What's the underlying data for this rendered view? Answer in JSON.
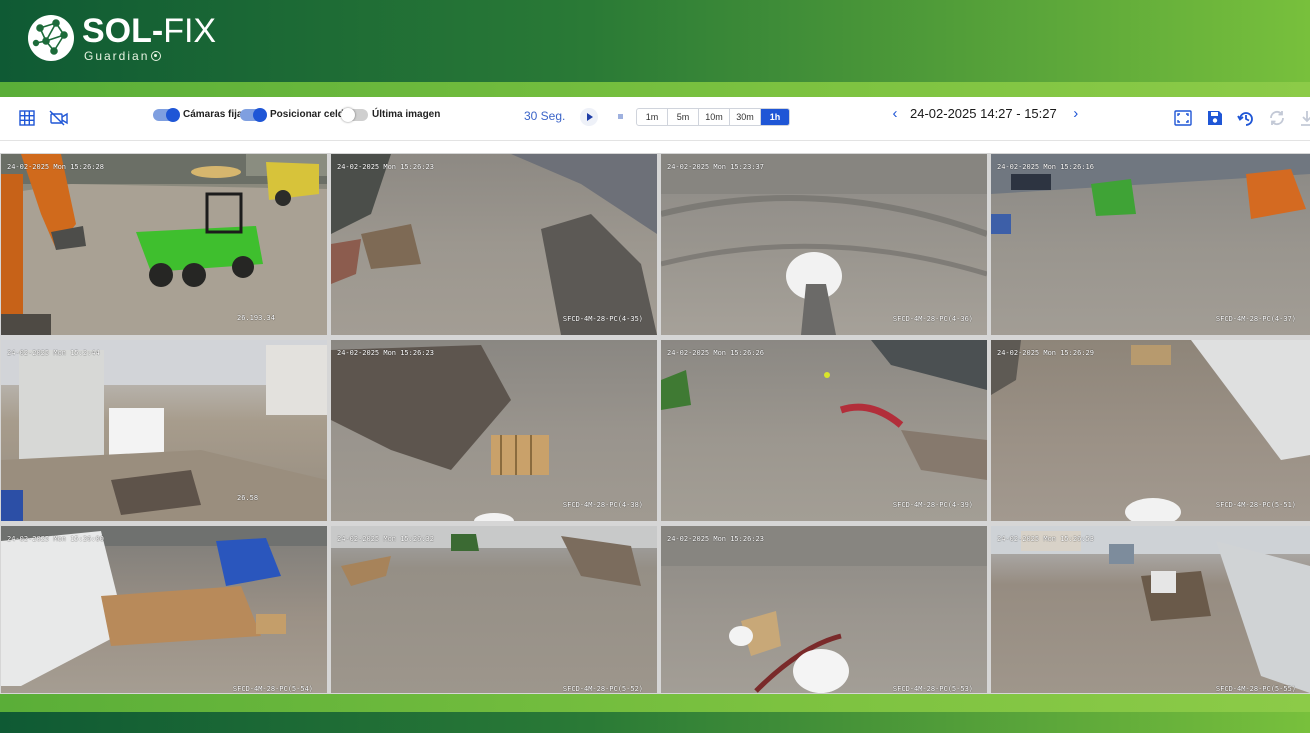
{
  "brand": {
    "name_bold": "SOL-",
    "name_light": "FIX",
    "sub": "Guardian"
  },
  "toolbar": {
    "toggles": [
      {
        "label": "Cámaras fijas",
        "on": true
      },
      {
        "label": "Posicionar celdas",
        "on": true
      },
      {
        "label": "Última imagen",
        "on": false
      }
    ],
    "interval_label": "30 Seg.",
    "ranges": [
      "1m",
      "5m",
      "10m",
      "30m",
      "1h"
    ],
    "active_range": "1h",
    "date_range": "24-02-2025 14:27 - 15:27"
  },
  "cameras": [
    {
      "timestamp": "24-02-2025 Mon 15:26:28",
      "id": "",
      "value": "26.193.34"
    },
    {
      "timestamp": "24-02-2025 Mon 15:26:23",
      "id": "SFCD-4M-28-PC(4-35)",
      "value": ""
    },
    {
      "timestamp": "24-02-2025 Mon 15:23:37",
      "id": "SFCD-4M-28-PC(4-36)",
      "value": ""
    },
    {
      "timestamp": "24-02-2025 Mon 15:26:16",
      "id": "SFCD-4M-28-PC(4-37)",
      "value": ""
    },
    {
      "timestamp": "24-02-2025 Mon 15:2:44",
      "id": "",
      "value": "26.58"
    },
    {
      "timestamp": "24-02-2025 Mon 15:26:23",
      "id": "SFCD-4M-28-PC(4-38)",
      "value": ""
    },
    {
      "timestamp": "24-02-2025 Mon 15:26:26",
      "id": "SFCD-4M-28-PC(4-39)",
      "value": ""
    },
    {
      "timestamp": "24-02-2025 Mon 15:26:29",
      "id": "SFCD-4M-28-PC(5-51)",
      "value": ""
    },
    {
      "timestamp": "24-02-2025 Mon 15:26:00",
      "id": "SFCD-4M-28-PC(5-54)",
      "value": ""
    },
    {
      "timestamp": "24-02-2025 Mon 15:26:32",
      "id": "SFCD-4M-28-PC(5-52)",
      "value": ""
    },
    {
      "timestamp": "24-02-2025 Mon 15:26:23",
      "id": "SFCD-4M-28-PC(5-53)",
      "value": ""
    },
    {
      "timestamp": "24-02-2025 Mon 15:26:53",
      "id": "SFCD-4M-28-PC(5-55)",
      "value": ""
    }
  ],
  "colors": {
    "header_dark": "#0f5a34",
    "header_light": "#78c03c",
    "accent": "#1f56d6"
  },
  "icons": [
    "grid-icon",
    "camera-off-icon",
    "fullscreen-icon",
    "save-icon",
    "history-icon",
    "refresh-icon",
    "download-icon"
  ]
}
